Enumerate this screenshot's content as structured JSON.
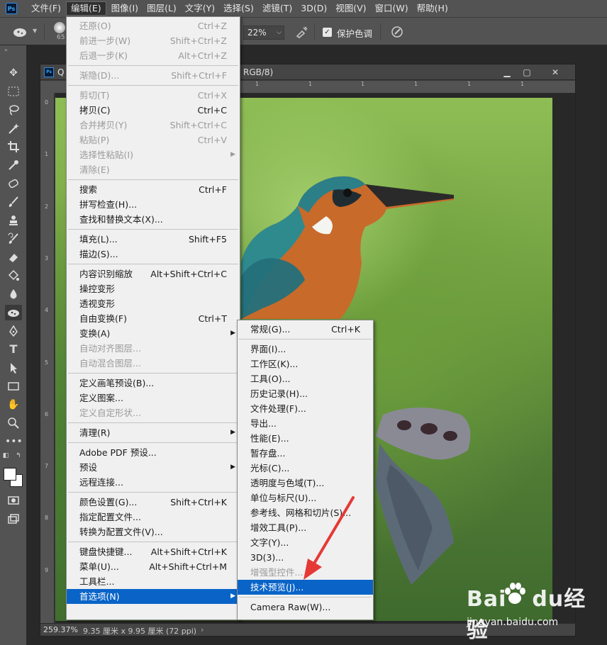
{
  "app": {
    "logo_text": "Ps"
  },
  "menubar": {
    "items": [
      "文件(F)",
      "编辑(E)",
      "图像(I)",
      "图层(L)",
      "文字(Y)",
      "选择(S)",
      "滤镜(T)",
      "3D(D)",
      "视图(V)",
      "窗口(W)",
      "帮助(H)"
    ],
    "active_index": 1
  },
  "options_bar": {
    "brush_size": "65",
    "zoom_value": "22%",
    "protect_tones_label": "保护色调",
    "protect_tones_checked": true
  },
  "document": {
    "title_prefix": "Q",
    "title_suffix": "RGB/8)",
    "zoom": "259.37%",
    "dimensions": "9.35 厘米 x 9.95 厘米 (72 ppi)",
    "ruler_h": [
      "1",
      "1",
      "1",
      "1",
      "1",
      "1"
    ],
    "ruler_v": [
      "0",
      "1",
      "2",
      "3",
      "4",
      "5",
      "6",
      "7",
      "8",
      "9"
    ]
  },
  "edit_menu": {
    "items": [
      {
        "label": "还原(O)",
        "shortcut": "Ctrl+Z",
        "disabled": true
      },
      {
        "label": "前进一步(W)",
        "shortcut": "Shift+Ctrl+Z",
        "disabled": true
      },
      {
        "label": "后退一步(K)",
        "shortcut": "Alt+Ctrl+Z",
        "disabled": true
      },
      {
        "sep": true
      },
      {
        "label": "渐隐(D)...",
        "shortcut": "Shift+Ctrl+F",
        "disabled": true
      },
      {
        "sep": true
      },
      {
        "label": "剪切(T)",
        "shortcut": "Ctrl+X",
        "disabled": true
      },
      {
        "label": "拷贝(C)",
        "shortcut": "Ctrl+C",
        "disabled": false
      },
      {
        "label": "合并拷贝(Y)",
        "shortcut": "Shift+Ctrl+C",
        "disabled": true
      },
      {
        "label": "粘贴(P)",
        "shortcut": "Ctrl+V",
        "disabled": true
      },
      {
        "label": "选择性粘贴(I)",
        "shortcut": "",
        "disabled": true,
        "submenu": true
      },
      {
        "label": "清除(E)",
        "shortcut": "",
        "disabled": true
      },
      {
        "sep": true
      },
      {
        "label": "搜索",
        "shortcut": "Ctrl+F",
        "disabled": false
      },
      {
        "label": "拼写检查(H)...",
        "shortcut": "",
        "disabled": false
      },
      {
        "label": "查找和替换文本(X)...",
        "shortcut": "",
        "disabled": false
      },
      {
        "sep": true
      },
      {
        "label": "填充(L)...",
        "shortcut": "Shift+F5",
        "disabled": false
      },
      {
        "label": "描边(S)...",
        "shortcut": "",
        "disabled": false
      },
      {
        "sep": true
      },
      {
        "label": "内容识别缩放",
        "shortcut": "Alt+Shift+Ctrl+C",
        "disabled": false
      },
      {
        "label": "操控变形",
        "shortcut": "",
        "disabled": false
      },
      {
        "label": "透视变形",
        "shortcut": "",
        "disabled": false
      },
      {
        "label": "自由变换(F)",
        "shortcut": "Ctrl+T",
        "disabled": false
      },
      {
        "label": "变换(A)",
        "shortcut": "",
        "disabled": false,
        "submenu": true
      },
      {
        "label": "自动对齐图层...",
        "shortcut": "",
        "disabled": true
      },
      {
        "label": "自动混合图层...",
        "shortcut": "",
        "disabled": true
      },
      {
        "sep": true
      },
      {
        "label": "定义画笔预设(B)...",
        "shortcut": "",
        "disabled": false
      },
      {
        "label": "定义图案...",
        "shortcut": "",
        "disabled": false
      },
      {
        "label": "定义自定形状...",
        "shortcut": "",
        "disabled": true
      },
      {
        "sep": true
      },
      {
        "label": "清理(R)",
        "shortcut": "",
        "disabled": false,
        "submenu": true
      },
      {
        "sep": true
      },
      {
        "label": "Adobe PDF 预设...",
        "shortcut": "",
        "disabled": false
      },
      {
        "label": "预设",
        "shortcut": "",
        "disabled": false,
        "submenu": true
      },
      {
        "label": "远程连接...",
        "shortcut": "",
        "disabled": false
      },
      {
        "sep": true
      },
      {
        "label": "颜色设置(G)...",
        "shortcut": "Shift+Ctrl+K",
        "disabled": false
      },
      {
        "label": "指定配置文件...",
        "shortcut": "",
        "disabled": false
      },
      {
        "label": "转换为配置文件(V)...",
        "shortcut": "",
        "disabled": false
      },
      {
        "sep": true
      },
      {
        "label": "键盘快捷键...",
        "shortcut": "Alt+Shift+Ctrl+K",
        "disabled": false
      },
      {
        "label": "菜单(U)...",
        "shortcut": "Alt+Shift+Ctrl+M",
        "disabled": false
      },
      {
        "label": "工具栏...",
        "shortcut": "",
        "disabled": false
      },
      {
        "label": "首选项(N)",
        "shortcut": "",
        "disabled": false,
        "submenu": true,
        "highlight": true
      }
    ]
  },
  "prefs_menu": {
    "items": [
      {
        "label": "常规(G)...",
        "shortcut": "Ctrl+K",
        "disabled": false
      },
      {
        "sep": true
      },
      {
        "label": "界面(I)...",
        "shortcut": "",
        "disabled": false
      },
      {
        "label": "工作区(K)...",
        "shortcut": "",
        "disabled": false
      },
      {
        "label": "工具(O)...",
        "shortcut": "",
        "disabled": false
      },
      {
        "label": "历史记录(H)...",
        "shortcut": "",
        "disabled": false
      },
      {
        "label": "文件处理(F)...",
        "shortcut": "",
        "disabled": false
      },
      {
        "label": "导出...",
        "shortcut": "",
        "disabled": false
      },
      {
        "label": "性能(E)...",
        "shortcut": "",
        "disabled": false
      },
      {
        "label": "暂存盘...",
        "shortcut": "",
        "disabled": false
      },
      {
        "label": "光标(C)...",
        "shortcut": "",
        "disabled": false
      },
      {
        "label": "透明度与色域(T)...",
        "shortcut": "",
        "disabled": false
      },
      {
        "label": "单位与标尺(U)...",
        "shortcut": "",
        "disabled": false
      },
      {
        "label": "参考线、网格和切片(S)...",
        "shortcut": "",
        "disabled": false
      },
      {
        "label": "增效工具(P)...",
        "shortcut": "",
        "disabled": false
      },
      {
        "label": "文字(Y)...",
        "shortcut": "",
        "disabled": false
      },
      {
        "label": "3D(3)...",
        "shortcut": "",
        "disabled": false
      },
      {
        "label": "增强型控件...",
        "shortcut": "",
        "disabled": true
      },
      {
        "label": "技术预览(J)...",
        "shortcut": "",
        "disabled": false,
        "highlight": true
      },
      {
        "sep": true
      },
      {
        "label": "Camera Raw(W)...",
        "shortcut": "",
        "disabled": false
      }
    ]
  },
  "watermark": {
    "brand_a": "Bai",
    "brand_b": "du",
    "brand_c": "经验",
    "url": "jingyan.baidu.com"
  },
  "colors": {
    "accent": "#0a64c8",
    "arrow": "#e53935",
    "ps_blue": "#31a8ff"
  }
}
